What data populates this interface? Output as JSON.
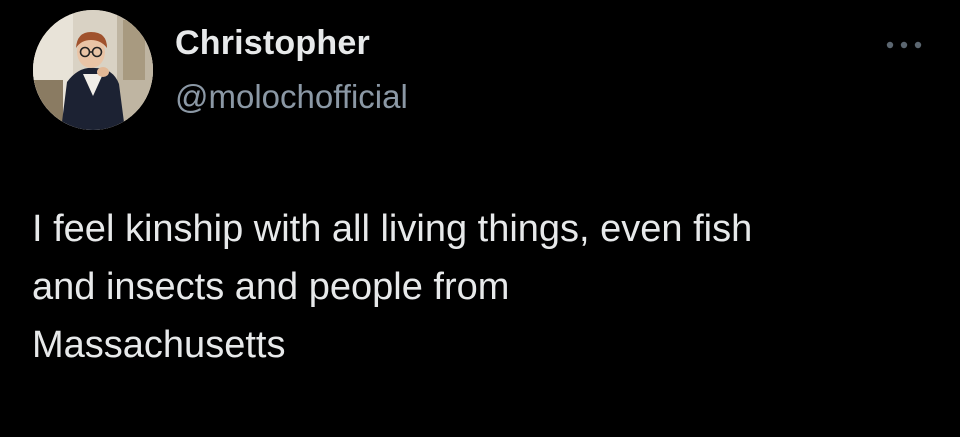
{
  "tweet": {
    "author": {
      "display_name": "Christopher",
      "handle": "@molochofficial",
      "avatar": "profile-photo"
    },
    "more_icon": "more-horizontal-icon",
    "text": "I feel kinship with all living things, even fish\nand insects and people from\nMassachusetts"
  },
  "colors": {
    "background": "#000000",
    "primary_text": "#e7e9ea",
    "secondary_text": "#8b98a5"
  }
}
